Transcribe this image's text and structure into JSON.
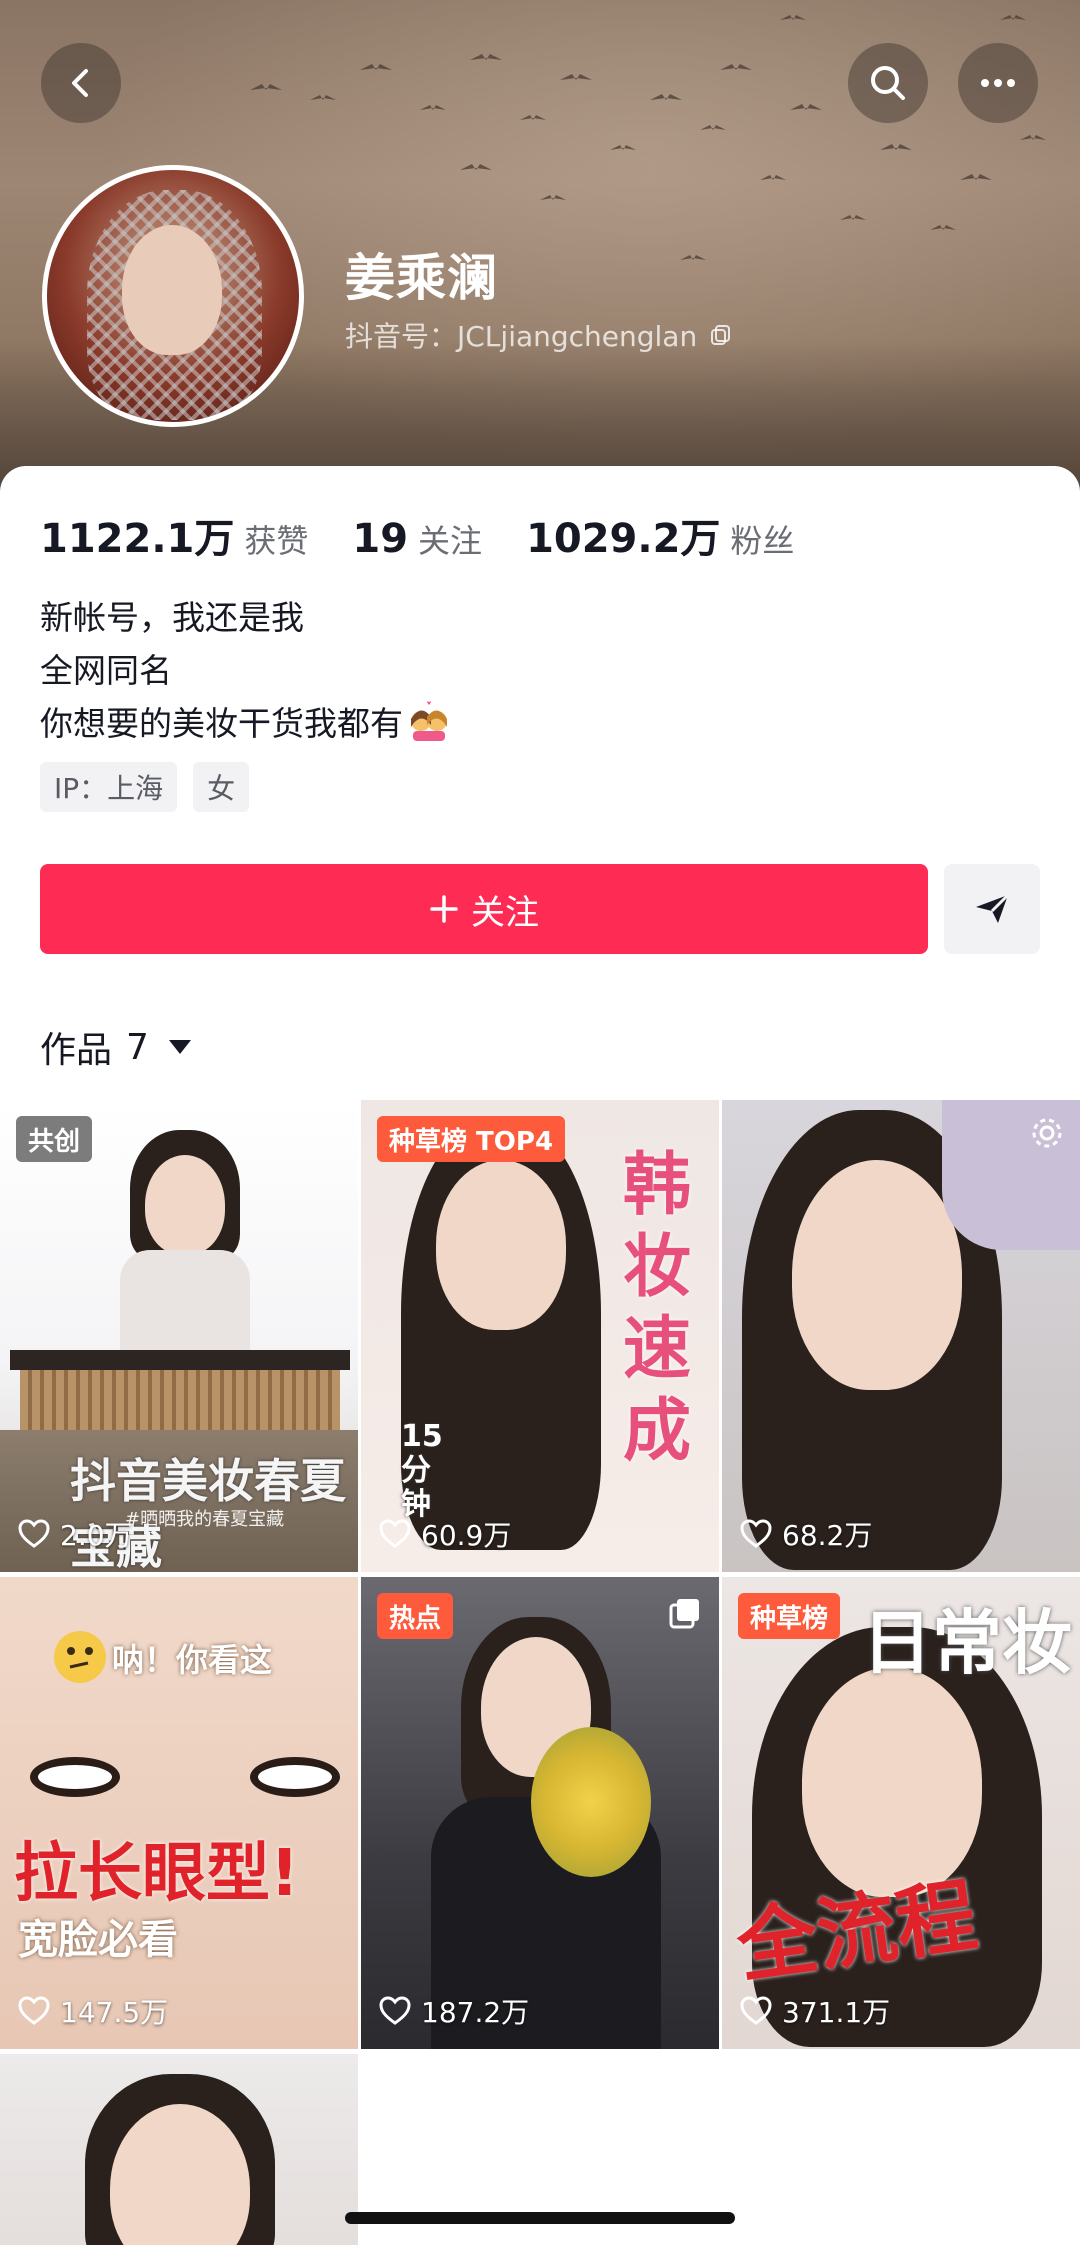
{
  "profile": {
    "nickname": "姜乘澜",
    "douyin_id": "抖音号：JCLjiangchenglan",
    "stats": [
      {
        "value": "1122.1万",
        "label": "获赞"
      },
      {
        "value": "19",
        "label": "关注"
      },
      {
        "value": "1029.2万",
        "label": "粉丝"
      }
    ],
    "bio": [
      "新帐号，我还是我",
      "全网同名",
      "你想要的美妆干货我都有"
    ],
    "tags": [
      "IP：上海",
      "女"
    ],
    "follow_label": "关注",
    "works_label": "作品",
    "works_count": "7"
  },
  "icons": {
    "back": "chevron-left-icon",
    "search": "search-icon",
    "more": "more-horizontal-icon",
    "copy": "copy-icon",
    "share": "send-icon",
    "like": "heart-outline-icon"
  },
  "colors": {
    "accent": "#fe2c55",
    "badge": "#fe5a3c"
  },
  "videos": [
    {
      "badge": "共创",
      "likes": "2.0万",
      "caption": "抖音美妆春夏宝藏",
      "subcaption": "#晒晒我的春夏宝藏"
    },
    {
      "badge": "种草榜 TOP4",
      "likes": "60.9万",
      "caption": "韩妆速成",
      "subcaption": "15分钟"
    },
    {
      "badge": "",
      "likes": "68.2万",
      "caption": "",
      "subcaption": ""
    },
    {
      "badge": "",
      "likes": "147.5万",
      "caption": "拉长眼型!",
      "subcaption": "宽脸必看",
      "top_text": "呐！你看这"
    },
    {
      "badge": "热点",
      "likes": "187.2万",
      "caption": "",
      "subcaption": ""
    },
    {
      "badge": "种草榜",
      "likes": "371.1万",
      "caption": "全流程",
      "subcaption": "日常妆"
    },
    {
      "badge": "",
      "likes": "",
      "caption": "",
      "subcaption": ""
    }
  ]
}
